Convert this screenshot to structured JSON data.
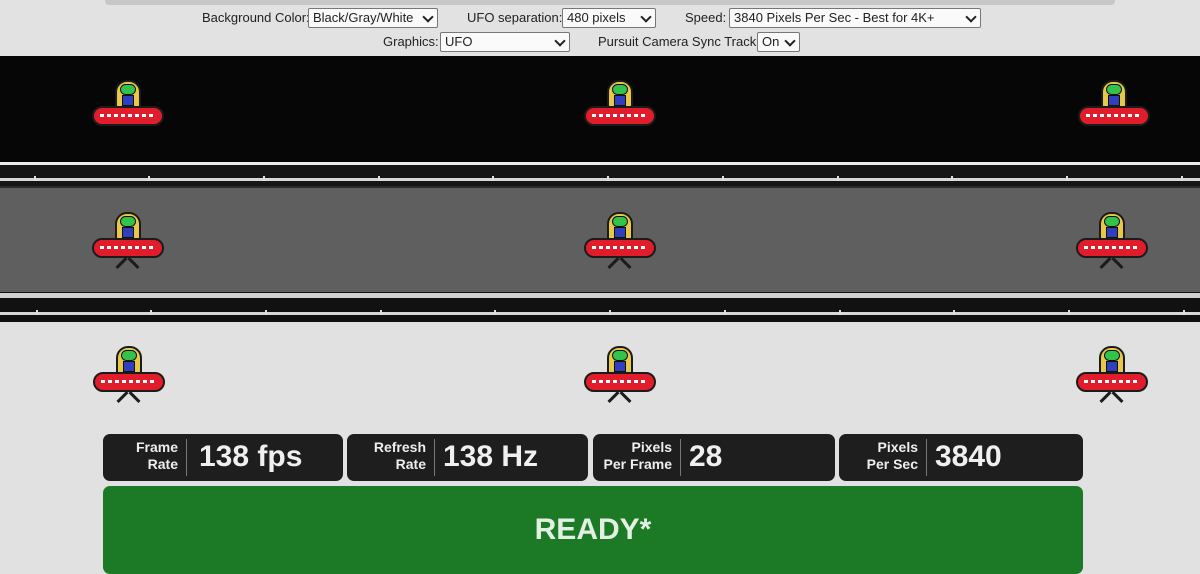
{
  "controls": {
    "background_color": {
      "label": "Background Color:",
      "value": "Black/Gray/White"
    },
    "ufo_separation": {
      "label": "UFO separation:",
      "value": "480 pixels"
    },
    "speed": {
      "label": "Speed:",
      "value": "3840 Pixels Per Sec - Best for 4K+"
    },
    "graphics": {
      "label": "Graphics:",
      "value": "UFO"
    },
    "pursuit_sync": {
      "label": "Pursuit Camera Sync Track:",
      "value": "On"
    }
  },
  "bands": [
    {
      "name": "black",
      "color": "#060606"
    },
    {
      "name": "gray",
      "color": "#5f5f5f"
    },
    {
      "name": "white",
      "color": "#e1e1e1"
    }
  ],
  "stats": {
    "frame_rate": {
      "label_line1": "Frame",
      "label_line2": "Rate",
      "value": "138 fps"
    },
    "refresh_rate": {
      "label_line1": "Refresh",
      "label_line2": "Rate",
      "value": "138 Hz"
    },
    "pixels_per_frame": {
      "label_line1": "Pixels",
      "label_line2": "Per Frame",
      "value": "28"
    },
    "pixels_per_sec": {
      "label_line1": "Pixels",
      "label_line2": "Per Sec",
      "value": "3840"
    }
  },
  "status": {
    "text": "READY*",
    "color": "#1c7a26"
  },
  "icons": [
    "ufo-icon",
    "chevron-down-icon"
  ]
}
